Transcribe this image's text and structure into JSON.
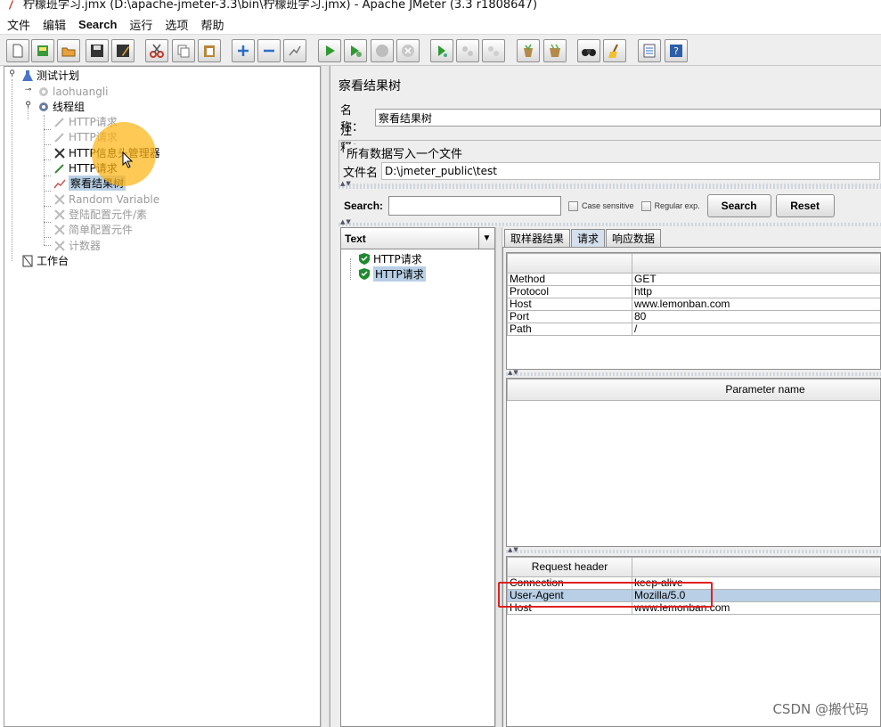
{
  "window": {
    "title": "柠檬班学习.jmx (D:\\apache-jmeter-3.3\\bin\\柠檬班学习.jmx) - Apache JMeter (3.3 r1808647)"
  },
  "menu": [
    "文件",
    "编辑",
    "Search",
    "运行",
    "选项",
    "帮助"
  ],
  "toolbar": {
    "buttons": [
      "new-icon",
      "templates-icon",
      "open-icon",
      "save-icon",
      "save-as-icon",
      "cut-icon",
      "copy-icon",
      "paste-icon",
      "expand-icon",
      "collapse-icon",
      "toggle-icon",
      "start-icon",
      "start-no-pause-icon",
      "stop-icon",
      "shutdown-icon",
      "remote-start-icon",
      "remote-stop-icon",
      "remote-shutdown-icon",
      "clear-icon",
      "clear-all-icon",
      "search-icon",
      "reset-search-icon",
      "function-helper-icon",
      "help-icon"
    ]
  },
  "tree": {
    "items": [
      {
        "label": "测试计划",
        "enabled": true
      },
      {
        "label": "laohuangli",
        "enabled": false
      },
      {
        "label": "线程组",
        "enabled": true
      },
      {
        "label": "HTTP请求",
        "enabled": false
      },
      {
        "label": "HTTP请求",
        "enabled": false
      },
      {
        "label": "HTTP信息头管理器",
        "enabled": true
      },
      {
        "label": "HTTP请求",
        "enabled": true
      },
      {
        "label": "察看结果树",
        "enabled": true,
        "selected": true
      },
      {
        "label": "Random Variable",
        "enabled": false
      },
      {
        "label": "登陆配置元件/素",
        "enabled": false
      },
      {
        "label": "简单配置元件",
        "enabled": false
      },
      {
        "label": "计数器",
        "enabled": false
      },
      {
        "label": "工作台",
        "enabled": true
      }
    ]
  },
  "panel": {
    "title": "察看结果树",
    "name_label": "名称：",
    "name_value": "察看结果树",
    "comment_label": "注释：",
    "comment_value": "",
    "file_group_title": "所有数据写入一个文件",
    "file_label": "文件名",
    "file_value": "D:\\jmeter_public\\test"
  },
  "search": {
    "label": "Search:",
    "value": "",
    "case_sensitive": "Case sensitive",
    "regular_exp": "Regular exp.",
    "search_button": "Search",
    "reset_button": "Reset"
  },
  "results": {
    "renderer": "Text",
    "samples": [
      {
        "label": "HTTP请求",
        "selected": false
      },
      {
        "label": "HTTP请求",
        "selected": true
      }
    ]
  },
  "tabs": [
    "取样器结果",
    "请求",
    "响应数据"
  ],
  "active_tab": "请求",
  "request_table": {
    "rows": [
      [
        "Method",
        "GET"
      ],
      [
        "Protocol",
        "http"
      ],
      [
        "Host",
        "www.lemonban.com"
      ],
      [
        "Port",
        "80"
      ],
      [
        "Path",
        "/"
      ]
    ]
  },
  "parameter_table": {
    "header": "Parameter name"
  },
  "header_table": {
    "header": "Request header",
    "rows": [
      [
        "Connection",
        "keep-alive"
      ],
      [
        "User-Agent",
        "Mozilla/5.0"
      ],
      [
        "Host",
        "www.lemonban.com"
      ]
    ]
  },
  "watermark": "CSDN @搬代码"
}
